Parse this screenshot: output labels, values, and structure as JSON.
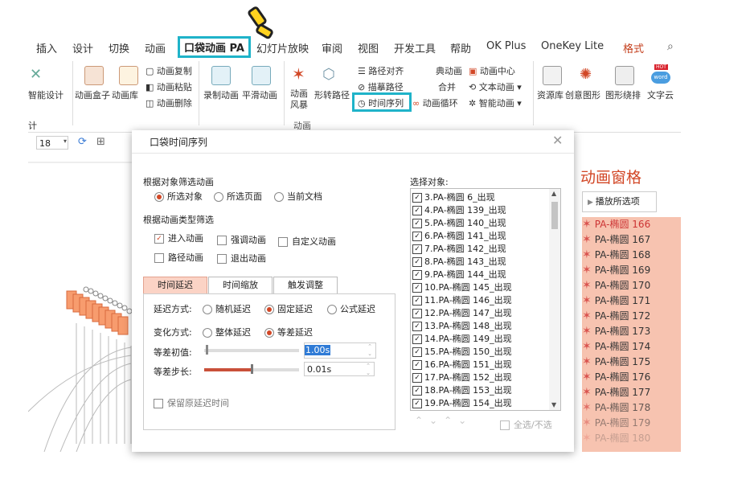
{
  "ribbon_tabs": [
    "插入",
    "设计",
    "切换",
    "动画",
    "口袋动画 PA",
    "幻灯片放映",
    "审阅",
    "视图",
    "开发工具",
    "帮助",
    "OK Plus",
    "OneKey Lite",
    "格式"
  ],
  "ribbon": {
    "g_left": "智能设计",
    "g_box": "动画盒子",
    "g_lib": "动画库",
    "copy": "动画复制",
    "paste": "动画粘贴",
    "delete": "动画删除",
    "record": "录制动画",
    "smooth": "平滑动画",
    "storm": "动画\n风暴",
    "morph": "形转路径",
    "align": "路径对齐",
    "trace": "描摹路径",
    "timeline": "时间序列",
    "classic": "典动画",
    "merge": "合并",
    "loop": "动画循环",
    "center": "动画中心",
    "textanim": "文本动画",
    "smartanim": "智能动画",
    "res": "资源库",
    "creative": "创意图形",
    "wrap": "图形绕排",
    "textcloud": "文字云",
    "group_label": "动画",
    "group_left": "计",
    "hot": "HOT",
    "word": "word"
  },
  "format_bar": {
    "font_size": "18"
  },
  "pane": {
    "title": "动画窗格",
    "play_button": "播放所选项",
    "items": [
      "PA-椭圆 166",
      "PA-椭圆 167",
      "PA-椭圆 168",
      "PA-椭圆 169",
      "PA-椭圆 170",
      "PA-椭圆 171",
      "PA-椭圆 172",
      "PA-椭圆 173",
      "PA-椭圆 174",
      "PA-椭圆 175",
      "PA-椭圆 176",
      "PA-椭圆 177",
      "PA-椭圆 178",
      "PA-椭圆 179",
      "PA-椭圆 180"
    ]
  },
  "dialog": {
    "title": "口袋时间序列",
    "filter_object_label": "根据对象筛选动画",
    "obj_options": [
      "所选对象",
      "所选页面",
      "当前文档"
    ],
    "filter_type_label": "根据动画类型筛选",
    "types": [
      "进入动画",
      "强调动画",
      "自定义动画",
      "路径动画",
      "退出动画"
    ],
    "subtabs": [
      "时间延迟",
      "时间缩放",
      "触发调整"
    ],
    "delay_mode_label": "延迟方式:",
    "delay_modes": [
      "随机延迟",
      "固定延迟",
      "公式延迟"
    ],
    "change_mode_label": "变化方式:",
    "change_modes": [
      "整体延迟",
      "等差延迟"
    ],
    "init_label": "等差初值:",
    "init_value": "1.00s",
    "step_label": "等差步长:",
    "step_value": "0.01s",
    "keep_label": "保留原延迟时间",
    "select_label": "选择对象:",
    "objects": [
      "3.PA-椭圆 6_出现",
      "4.PA-椭圆 139_出现",
      "5.PA-椭圆 140_出现",
      "6.PA-椭圆 141_出现",
      "7.PA-椭圆 142_出现",
      "8.PA-椭圆 143_出现",
      "9.PA-椭圆 144_出现",
      "10.PA-椭圆 145_出现",
      "11.PA-椭圆 146_出现",
      "12.PA-椭圆 147_出现",
      "13.PA-椭圆 148_出现",
      "14.PA-椭圆 149_出现",
      "15.PA-椭圆 150_出现",
      "16.PA-椭圆 151_出现",
      "17.PA-椭圆 152_出现",
      "18.PA-椭圆 153_出现",
      "19.PA-椭圆 154_出现"
    ],
    "select_all": "全选/不选"
  },
  "colors": {
    "accent": "#d24726",
    "highlight": "#1fb3c9",
    "pane_item": "#f7c3b0",
    "tab_active": "#fbd3c5"
  }
}
